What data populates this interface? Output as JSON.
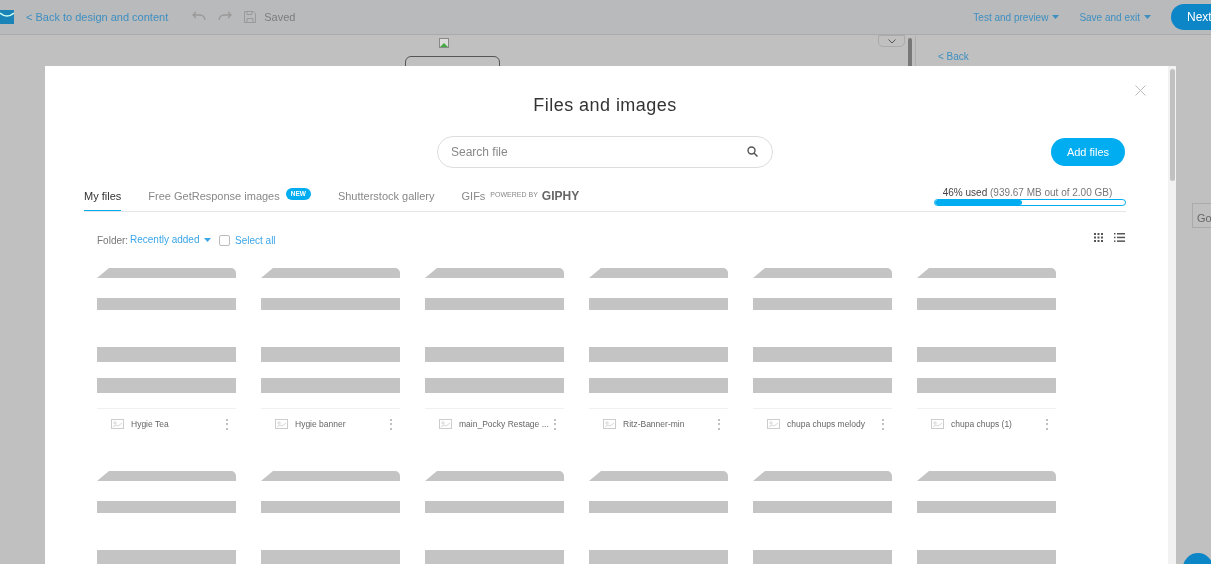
{
  "topbar": {
    "back_link": "< Back to design and content",
    "saved": "Saved",
    "menus": [
      "Test and preview",
      "Save and exit"
    ],
    "next_button": "Next"
  },
  "background": {
    "back_link": "< Back",
    "cell": "Go"
  },
  "modal": {
    "title": "Files and images",
    "search": {
      "placeholder": "Search file"
    },
    "add_button": "Add files",
    "tabs": [
      {
        "label": "My files",
        "selected": true
      },
      {
        "label": "Free GetResponse images",
        "badge": "NEW",
        "selected": false
      },
      {
        "label": "Shutterstock gallery",
        "selected": false
      },
      {
        "label": "GIFs",
        "powered_by": "POWERED BY",
        "brand": "GIPHY",
        "selected": false
      }
    ],
    "storage": {
      "used": "46% used",
      "detail": "(939.67 MB out of 2.00 GB)",
      "level": 0.46
    },
    "folder": {
      "label": "Folder:",
      "value": "Recently added"
    },
    "select_all": {
      "label": "Select all",
      "checked": false
    },
    "files": [
      {
        "kind": "named",
        "name": "Hygie Tea"
      },
      {
        "kind": "named",
        "name": "Hygie banner"
      },
      {
        "kind": "named",
        "name": "main_Pocky Restage ..."
      },
      {
        "kind": "named",
        "name": "Ritz-Banner-min"
      },
      {
        "kind": "named",
        "name": "chupa chups melody"
      },
      {
        "kind": "named",
        "name": "chupa chups (1)"
      },
      {
        "kind": "loading"
      },
      {
        "kind": "loading"
      },
      {
        "kind": "loading"
      },
      {
        "kind": "loading"
      },
      {
        "kind": "loading"
      },
      {
        "kind": "loading"
      }
    ]
  }
}
